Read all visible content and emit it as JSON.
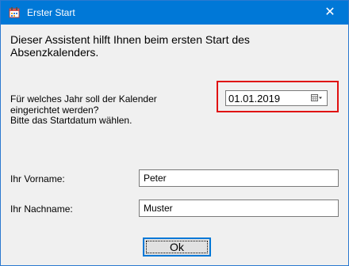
{
  "window": {
    "title": "Erster Start",
    "close_glyph": "✕",
    "icon": "calendar-app-icon"
  },
  "intro_text": "Dieser Assistent hilft Ihnen beim ersten Start des Absenzkalenders.",
  "question": {
    "line1": "Für welches Jahr soll der Kalender",
    "line2": "eingerichtet werden?",
    "line3": "Bitte das Startdatum wählen."
  },
  "date_picker": {
    "value": "01.01.2019",
    "icon": "calendar-dropdown-icon"
  },
  "first_name": {
    "label": "Ihr Vorname:",
    "value": "Peter"
  },
  "last_name": {
    "label": "Ihr Nachname:",
    "value": "Muster"
  },
  "ok_button": {
    "label": "Ok"
  },
  "colors": {
    "titlebar": "#0078d7",
    "highlight": "#e01010",
    "dialog_bg": "#f0f0f0"
  }
}
